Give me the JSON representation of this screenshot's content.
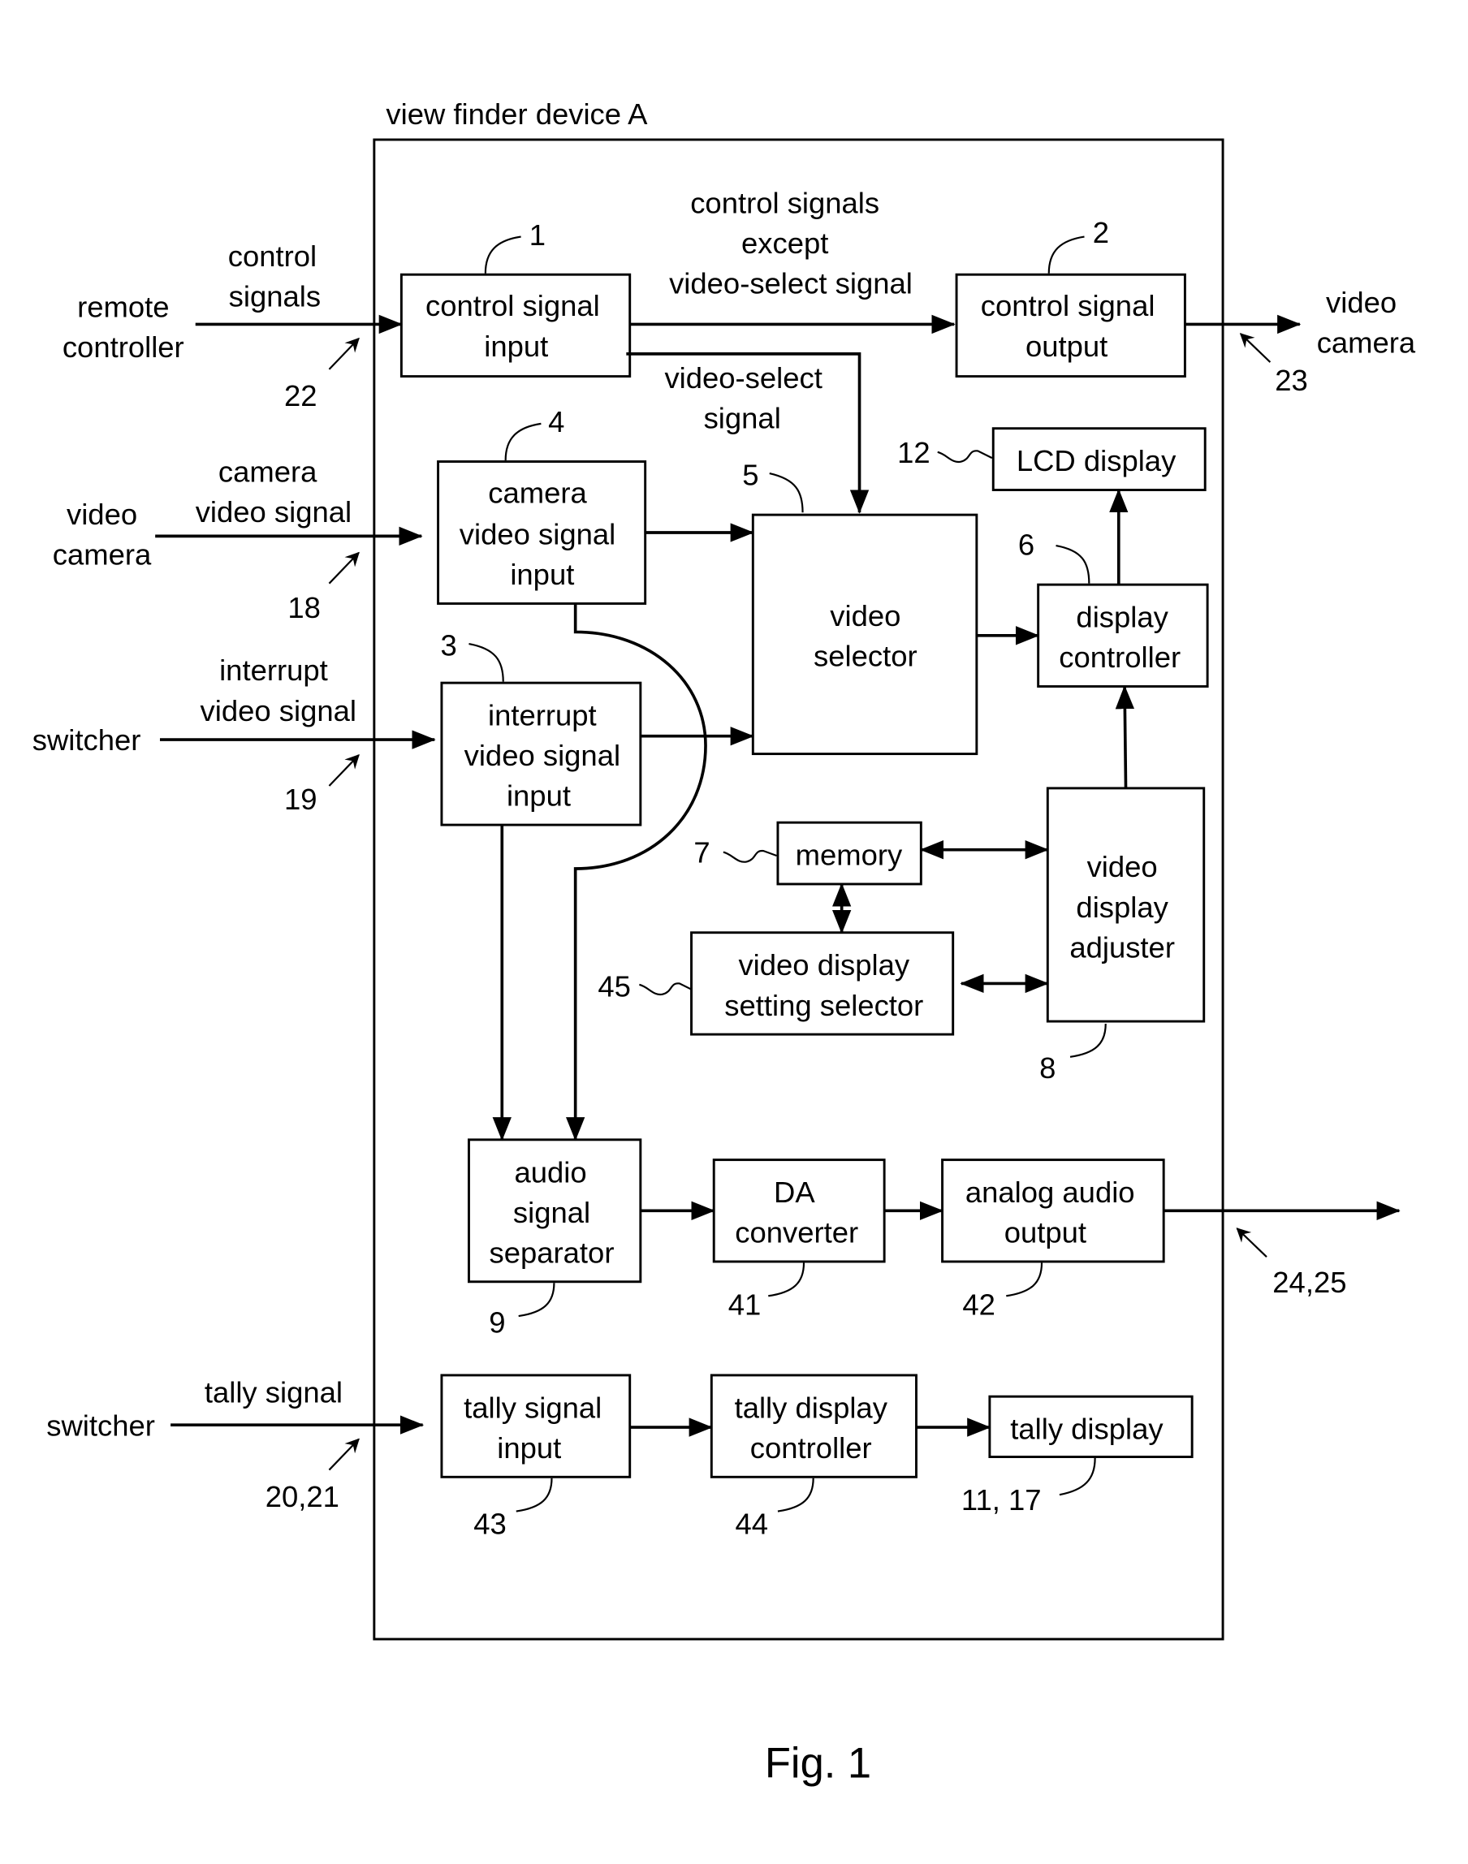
{
  "device_title": "view finder device A",
  "figure_caption": "Fig. 1",
  "blocks": {
    "control_signal_input": {
      "lines": [
        "control signal",
        "input"
      ],
      "ref": "1"
    },
    "control_signal_output": {
      "lines": [
        "control signal",
        "output"
      ],
      "ref": "2"
    },
    "interrupt_video_signal_input": {
      "lines": [
        "interrupt",
        "video signal",
        "input"
      ],
      "ref": "3"
    },
    "camera_video_signal_input": {
      "lines": [
        "camera",
        "video signal",
        "input"
      ],
      "ref": "4"
    },
    "video_selector": {
      "lines": [
        "video",
        "selector"
      ],
      "ref": "5"
    },
    "display_controller": {
      "lines": [
        "display",
        "controller"
      ],
      "ref": "6"
    },
    "memory": {
      "lines": [
        "memory"
      ],
      "ref": "7"
    },
    "video_display_adjuster": {
      "lines": [
        "video",
        "display",
        "adjuster"
      ],
      "ref": "8"
    },
    "audio_signal_separator": {
      "lines": [
        "audio",
        "signal",
        "separator"
      ],
      "ref": "9"
    },
    "lcd_display": {
      "lines": [
        "LCD display"
      ],
      "ref": "12"
    },
    "da_converter": {
      "lines": [
        "DA",
        "converter"
      ],
      "ref": "41"
    },
    "analog_audio_output": {
      "lines": [
        "analog audio",
        "output"
      ],
      "ref": "42"
    },
    "tally_signal_input": {
      "lines": [
        "tally signal",
        "input"
      ],
      "ref": "43"
    },
    "tally_display_controller": {
      "lines": [
        "tally display",
        "controller"
      ],
      "ref": "44"
    },
    "tally_display": {
      "lines": [
        "tally display"
      ],
      "ref": "11, 17"
    },
    "video_display_setting_selector": {
      "lines": [
        "video display",
        "setting selector"
      ],
      "ref": "45"
    }
  },
  "external": {
    "remote_controller": {
      "lines": [
        "remote",
        "controller"
      ],
      "signal": [
        "control",
        "signals"
      ],
      "ref": "22"
    },
    "video_camera_in": {
      "lines": [
        "video",
        "camera"
      ],
      "signal": [
        "camera",
        "video signal"
      ],
      "ref": "18"
    },
    "switcher_interrupt": {
      "lines": [
        "switcher"
      ],
      "signal": [
        "interrupt",
        "video signal"
      ],
      "ref": "19"
    },
    "switcher_tally": {
      "lines": [
        "switcher"
      ],
      "signal": [
        "tally signal"
      ],
      "ref": "20,21"
    },
    "video_camera_out": {
      "lines": [
        "video",
        "camera"
      ],
      "ref": "23"
    },
    "audio_out": {
      "ref": "24,25"
    }
  },
  "signals": {
    "control_except": [
      "control signals",
      "except",
      "video-select signal"
    ],
    "video_select": [
      "video-select",
      "signal"
    ]
  }
}
